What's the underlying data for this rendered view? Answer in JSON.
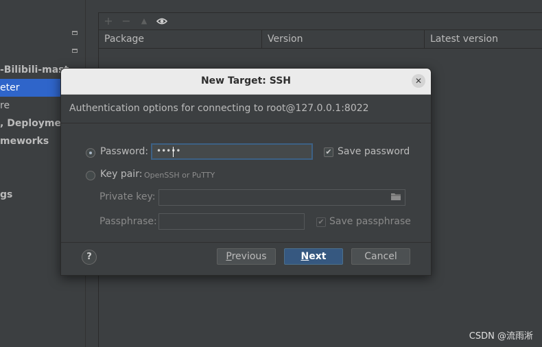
{
  "sidebar": {
    "items": [
      {
        "label": "-Bilibili-mast",
        "bold": true
      },
      {
        "label": "eter",
        "bold": false,
        "selected": true
      },
      {
        "label": "re",
        "bold": false
      },
      {
        "label": ", Deployment",
        "bold": true
      },
      {
        "label": "meworks",
        "bold": true
      },
      {
        "label": "gs",
        "bold": true
      }
    ]
  },
  "packages": {
    "toolbar": [
      "add-icon",
      "remove-icon",
      "upgrade-icon",
      "eye-icon"
    ],
    "columns": [
      "Package",
      "Version",
      "Latest version"
    ]
  },
  "dialog": {
    "title": "New Target: SSH",
    "subtitle": "Authentication options for connecting to root@127.0.0.1:8022",
    "password_label": "Password:",
    "password_value": "•••••",
    "save_password_label": "Save password",
    "save_password_checked": true,
    "keypair_label": "Key pair:",
    "keypair_hint": "OpenSSH or PuTTY",
    "private_key_label": "Private key:",
    "private_key_value": "",
    "passphrase_label": "Passphrase:",
    "passphrase_value": "",
    "save_passphrase_label": "Save passphrase",
    "save_passphrase_checked": true,
    "auth_selected": "password",
    "help_label": "?",
    "previous_label": "revious",
    "previous_mnemonic": "P",
    "next_label": "ext",
    "next_mnemonic": "N",
    "cancel_label": "Cancel"
  },
  "watermark": "CSDN @流雨淅",
  "colors": {
    "accent": "#2f65ca",
    "primary_button": "#365880",
    "background": "#3c3f41"
  }
}
